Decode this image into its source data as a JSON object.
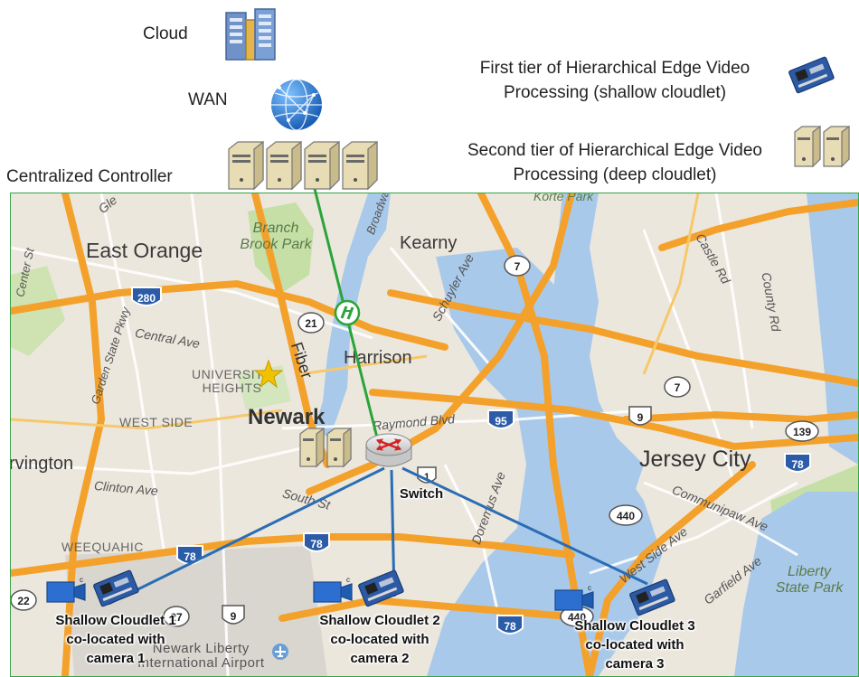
{
  "top": {
    "cloud_label": "Cloud",
    "wan_label": "WAN",
    "controller_label": "Centralized Controller"
  },
  "legend": {
    "first_tier_line1": "First tier of Hierarchical Edge Video",
    "first_tier_line2": "Processing (shallow cloudlet)",
    "second_tier_line1": "Second tier of Hierarchical Edge Video",
    "second_tier_line2": "Processing (deep cloudlet)"
  },
  "links": {
    "fiber_label": "Fiber",
    "switch_label": "Switch"
  },
  "cloudlets": [
    {
      "line1": "Shallow Cloudlet 1",
      "line2": "co-located with",
      "line3": "camera 1",
      "camera_tag": "c"
    },
    {
      "line1": "Shallow Cloudlet 2",
      "line2": "co-located with",
      "line3": "camera 2",
      "camera_tag": "c"
    },
    {
      "line1": "Shallow Cloudlet 3",
      "line2": "co-located with",
      "line3": "camera 3",
      "camera_tag": "c"
    }
  ],
  "map": {
    "places": {
      "east_orange": "East Orange",
      "branch_brook_park_1": "Branch",
      "branch_brook_park_2": "Brook Park",
      "kearny": "Kearny",
      "newark": "Newark",
      "harrison": "Harrison",
      "jersey_city": "Jersey City",
      "irvington": "rvington",
      "university_heights_1": "UNIVERSITY",
      "university_heights_2": "HEIGHTS",
      "west_side": "WEST SIDE",
      "weequahic": "WEEQUAHIC",
      "liberty_park_1": "Liberty",
      "liberty_park_2": "State Park",
      "airport_1": "Newark Liberty",
      "airport_2": "International Airport",
      "korte_park": "Korte Park"
    },
    "streets": {
      "central_ave": "Central Ave",
      "clinton_ave": "Clinton Ave",
      "schuyler_ave": "Schuyler Ave",
      "raymond_blvd": "Raymond Blvd",
      "garden_state_pkwy": "Garden State Pkwy",
      "communipaw_ave": "Communipaw Ave",
      "west_side_ave": "West Side Ave",
      "garfield_ave": "Garfield Ave",
      "doremus_ave": "Doremus Ave",
      "castle_rd": "Castle Rd",
      "county_rd": "County Rd",
      "broadway": "Broadway",
      "center_st": "Center St",
      "glen": "Gle",
      "south_st": "South St"
    },
    "shields": {
      "i280": "280",
      "i95": "95",
      "i78a": "78",
      "i78b": "78",
      "i78c": "78",
      "i78d": "78",
      "rt7a": "7",
      "rt7b": "7",
      "rt21": "21",
      "rt139": "139",
      "rt440a": "440",
      "rt440b": "440",
      "us9a": "9",
      "us9b": "9",
      "us1": "1",
      "rt27": "27",
      "rt22": "22"
    }
  },
  "colors": {
    "fiber_link": "#2aa43a",
    "wireless_link": "#2a6db5",
    "map_border": "#3aa34a",
    "highway": "#f3a12b",
    "water": "#a9c9ea",
    "land": "#ece7dd",
    "park": "#c5dfa6"
  }
}
